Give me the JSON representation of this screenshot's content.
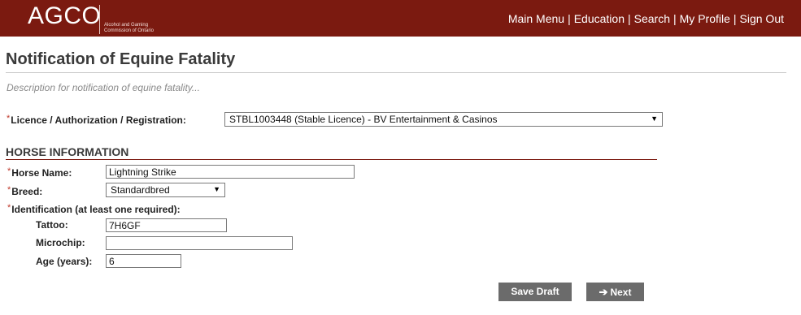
{
  "header": {
    "logo_text": "AGCO",
    "logo_subtitle_line1": "Alcohol and Gaming",
    "logo_subtitle_line2": "Commission of Ontario",
    "nav": [
      {
        "label": "Main Menu"
      },
      {
        "label": "Education"
      },
      {
        "label": "Search"
      },
      {
        "label": "My Profile"
      },
      {
        "label": "Sign Out"
      }
    ],
    "nav_separator": "|",
    "brand_color": "#7b1a10"
  },
  "page": {
    "title": "Notification of Equine Fatality",
    "description": "Description for notification of equine fatality..."
  },
  "required_marker": "*",
  "licence": {
    "label": "Licence / Authorization / Registration:",
    "selected": "STBL1003448 (Stable Licence) - BV Entertainment & Casinos"
  },
  "horse_info": {
    "section_title": "HORSE INFORMATION",
    "name_label": "Horse Name:",
    "name_value": "Lightning Strike",
    "breed_label": "Breed:",
    "breed_selected": "Standardbred",
    "identification_label": "Identification (at least one required):",
    "tattoo_label": "Tattoo:",
    "tattoo_value": "7H6GF",
    "microchip_label": "Microchip:",
    "microchip_value": "",
    "age_label": "Age (years):",
    "age_value": "6"
  },
  "actions": {
    "save_draft": "Save Draft",
    "next": "Next"
  },
  "icons": {
    "dropdown": "chevron-down-icon",
    "next_arrow": "arrow-right-icon"
  }
}
